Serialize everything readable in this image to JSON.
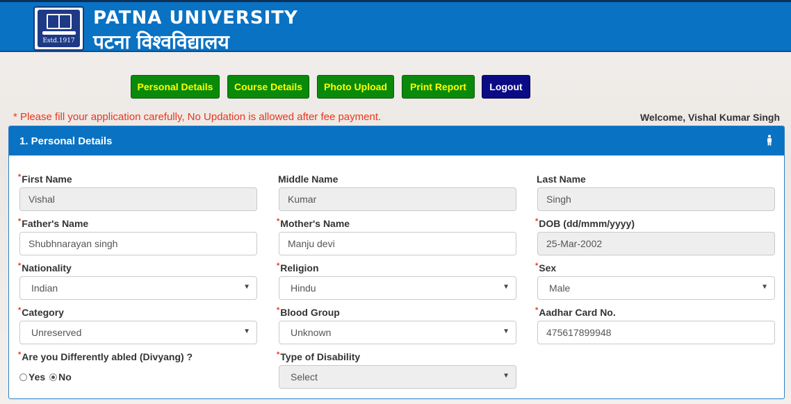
{
  "header": {
    "title_en": "PATNA UNIVERSITY",
    "title_hi": "पटना विश्वविद्यालय",
    "logo_text": "Estd.1917"
  },
  "nav": {
    "personal_details": "Personal Details",
    "course_details": "Course Details",
    "photo_upload": "Photo Upload",
    "print_report": "Print Report",
    "logout": "Logout"
  },
  "notice": "* Please fill your application carefully, No Updation is allowed after fee payment.",
  "welcome": "Welcome, Vishal Kumar Singh",
  "panel": {
    "title": "1. Personal Details"
  },
  "labels": {
    "first_name": "First Name",
    "middle_name": "Middle Name",
    "last_name": "Last Name",
    "father_name": "Father's Name",
    "mother_name": "Mother's Name",
    "dob": "DOB (dd/mmm/yyyy)",
    "nationality": "Nationality",
    "religion": "Religion",
    "sex": "Sex",
    "category": "Category",
    "blood_group": "Blood Group",
    "aadhar": "Aadhar Card No.",
    "divyang": "Are you Differently abled (Divyang) ?",
    "disability_type": "Type of Disability",
    "yes": "Yes",
    "no": "No"
  },
  "values": {
    "first_name": "Vishal",
    "middle_name": "Kumar",
    "last_name": "Singh",
    "father_name": "Shubhnarayan singh",
    "mother_name": "Manju devi",
    "dob": "25-Mar-2002",
    "nationality": "Indian",
    "religion": "Hindu",
    "sex": "Male",
    "category": "Unreserved",
    "blood_group": "Unknown",
    "aadhar": "475617899948",
    "disability_type": "Select",
    "divyang": "No"
  },
  "colors": {
    "header_blue": "#0972c3",
    "nav_green": "#0a8a0a",
    "nav_text_yellow": "#ffff00",
    "logout_navy": "#0b0b86",
    "notice_red": "#e8361d"
  }
}
